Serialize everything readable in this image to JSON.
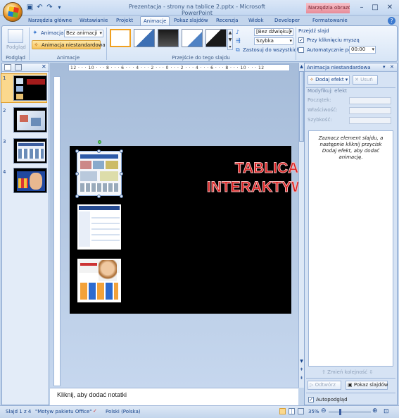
{
  "window": {
    "title": "Prezentacja - strony na tablice 2.pptx - Microsoft PowerPoint",
    "contextual_tools": "Narzędzia obrazów",
    "controls": [
      "–",
      "□",
      "✕"
    ]
  },
  "tabs": [
    "Narzędzia główne",
    "Wstawianie",
    "Projekt",
    "Animacje",
    "Pokaz slajdów",
    "Recenzja",
    "Widok",
    "Developer",
    "Formatowanie"
  ],
  "active_tab": "Animacje",
  "ribbon": {
    "preview_label": "Podgląd",
    "group_preview": "Podgląd",
    "animate_label": "Animacja:",
    "animate_value": "Bez animacji",
    "custom_anim": "Animacja niestandardowa",
    "group_anim": "Animacje",
    "sound_value": "[Bez dźwięku]",
    "speed_value": "Szybka",
    "apply_all": "Zastosuj do wszystkich",
    "group_transition": "Przejście do tego slajdu",
    "advance_title": "Przejdź slajd",
    "on_click": "Przy kliknięciu myszą",
    "auto_after": "Automatycznie po:",
    "auto_value": "00:00"
  },
  "ruler": "12 · · · 10 · · · 8 · · · 6 · · · 4 · · · 2 · · · 0 · · · 2 · · · 4 · · · 6 · · · 8 · · · 10 · · · 12",
  "slides": [
    "1",
    "2",
    "3",
    "4"
  ],
  "slide": {
    "title_line1": "TABLICA",
    "title_line2": "INTERAKTYWNA"
  },
  "notes_placeholder": "Kliknij, aby dodać notatki",
  "task_pane": {
    "title": "Animacja niestandardowa",
    "add_effect": "Dodaj efekt",
    "remove": "Usuń",
    "modify_section": "Modyfikuj: efekt",
    "start_label": "Początek:",
    "property_label": "Właściwość:",
    "speed_label": "Szybkość:",
    "hint": "Zaznacz element slajdu, a następnie kliknij przycisk Dodaj efekt, aby dodać animację.",
    "reorder": "Zmień kolejność",
    "play": "Odtwórz",
    "slideshow": "Pokaz slajdów",
    "autopreview": "Autopodgląd"
  },
  "status": {
    "slide_info": "Slajd 1 z 4",
    "theme": "\"Motyw pakietu Office\"",
    "language": "Polski (Polska)",
    "zoom": "35%"
  }
}
